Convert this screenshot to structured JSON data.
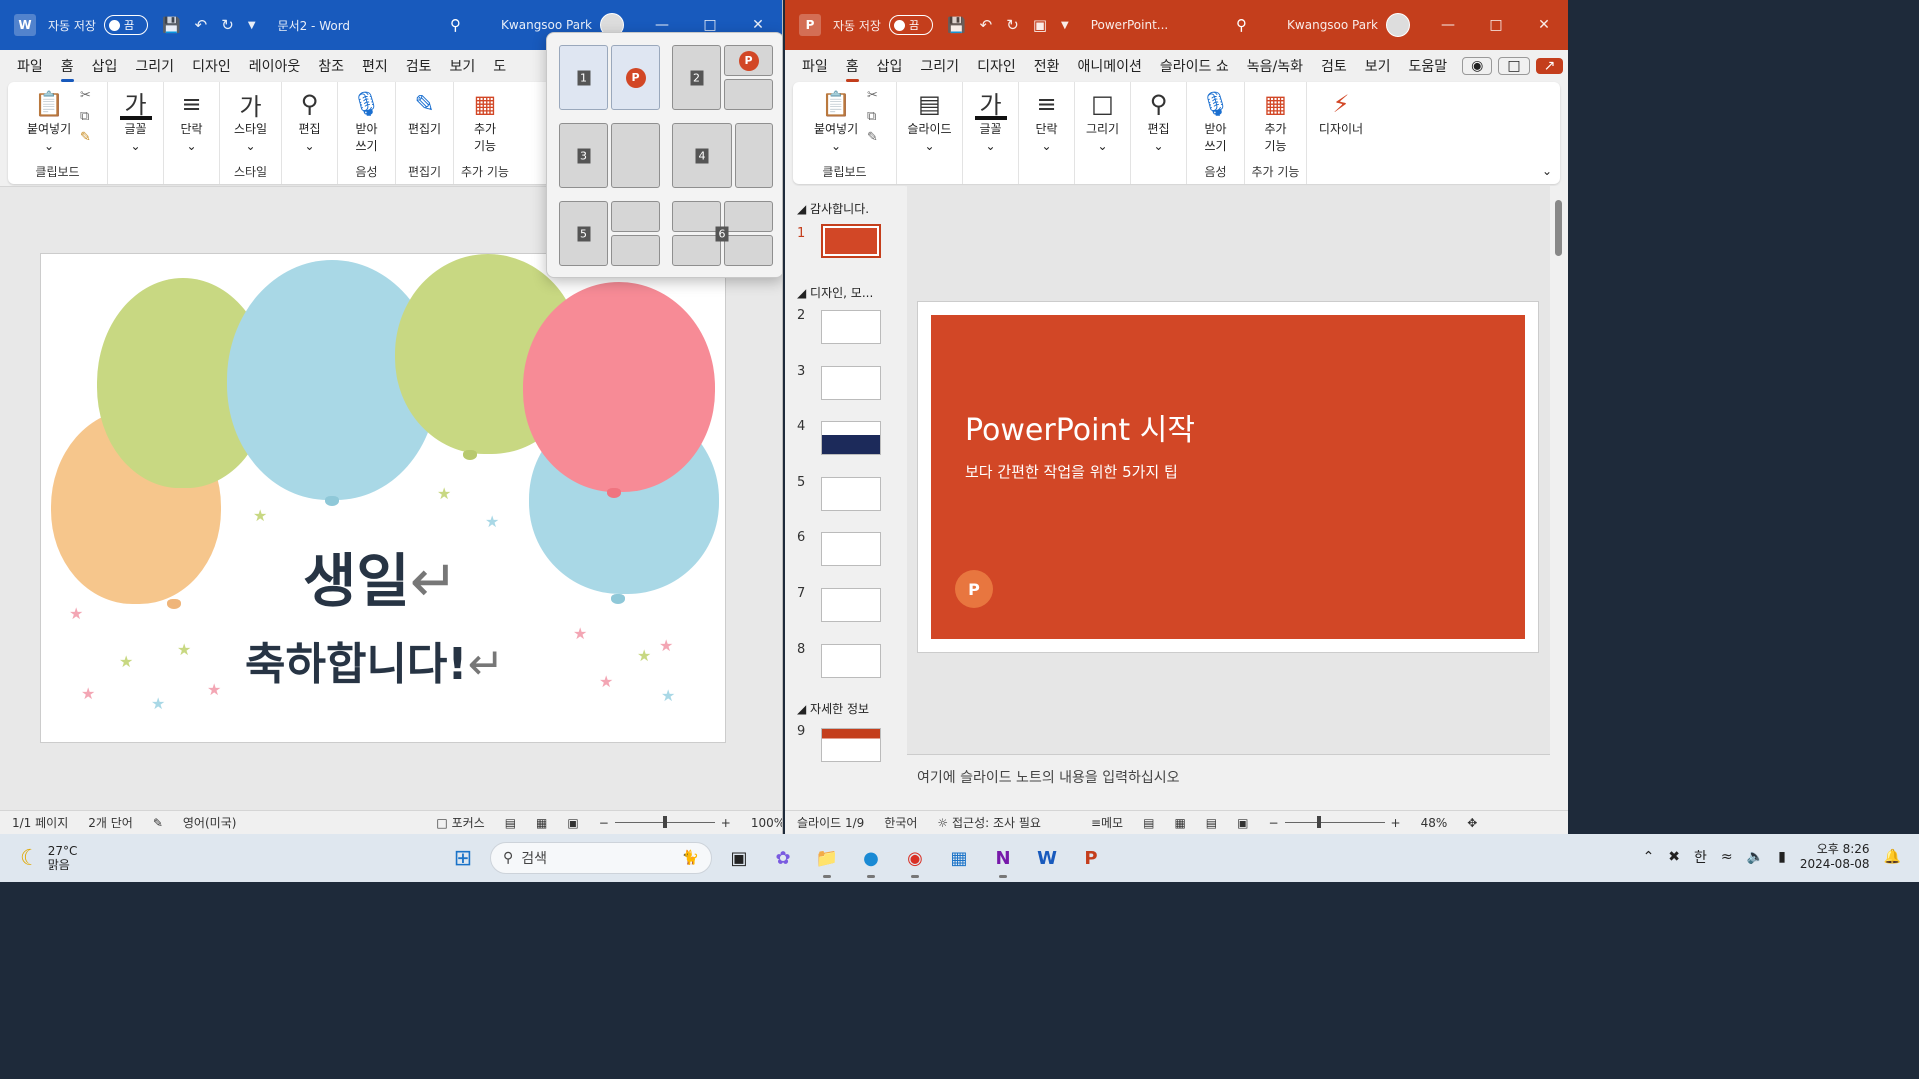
{
  "word": {
    "app_icon": "W",
    "autosave_label": "자동 저장",
    "autosave_state": "끔",
    "doc_title": "문서2  -  Word",
    "user": "Kwangsoo Park",
    "menu": [
      "파일",
      "홈",
      "삽입",
      "그리기",
      "디자인",
      "레이아웃",
      "참조",
      "편지",
      "검토",
      "보기",
      "도"
    ],
    "active_menu": "홈",
    "ribbon": {
      "paste": "붙여넣기",
      "clipboard_group": "클립보드",
      "font": "글꼴",
      "paragraph": "단락",
      "styles": "스타일",
      "styles_group": "스타일",
      "editing": "편집",
      "dictate_1": "받아",
      "dictate_2": "쓰기",
      "voice_group": "음성",
      "editor": "편집기",
      "editor_group": "편집기",
      "addins_1": "추가",
      "addins_2": "기능",
      "addins_group": "추가 기능"
    },
    "doc": {
      "line1": "생일",
      "line2": "축하합니다!",
      "para_mark": "↵"
    },
    "status": {
      "page": "1/1 페이지",
      "words": "2개 단어",
      "lang": "영어(미국)",
      "focus": "포커스",
      "zoom": "100%"
    }
  },
  "snap_layouts": {
    "zones": [
      "1",
      "2",
      "3",
      "4",
      "5",
      "6"
    ]
  },
  "ppt": {
    "app_icon": "P",
    "autosave_label": "자동 저장",
    "autosave_state": "끔",
    "doc_title": "PowerPoint...",
    "user": "Kwangsoo Park",
    "menu": [
      "파일",
      "홈",
      "삽입",
      "그리기",
      "디자인",
      "전환",
      "애니메이션",
      "슬라이드 쇼",
      "녹음/녹화",
      "검토",
      "보기",
      "도움말"
    ],
    "active_menu": "홈",
    "ribbon": {
      "paste": "붙여넣기",
      "clipboard_group": "클립보드",
      "slides": "슬라이드",
      "font": "글꼴",
      "paragraph": "단락",
      "drawing": "그리기",
      "editing": "편집",
      "dictate_1": "받아",
      "dictate_2": "쓰기",
      "voice_group": "음성",
      "addins_1": "추가",
      "addins_2": "기능",
      "addins_group": "추가 기능",
      "designer": "디자이너"
    },
    "sections": [
      {
        "title": "감사합니다.",
        "slides": [
          "1"
        ]
      },
      {
        "title": "디자인, 모...",
        "slides": [
          "2",
          "3",
          "4",
          "5",
          "6",
          "7",
          "8"
        ]
      },
      {
        "title": "자세한 정보",
        "slides": [
          "9"
        ]
      }
    ],
    "slide": {
      "title": "PowerPoint 시작",
      "subtitle": "보다 간편한 작업을 위한 5가지 팁",
      "logo": "P"
    },
    "notes_placeholder": "여기에 슬라이드 노트의 내용을 입력하십시오",
    "status": {
      "slide": "슬라이드 1/9",
      "lang": "한국어",
      "access": "접근성: 조사 필요",
      "memo": "메모",
      "zoom": "48%"
    }
  },
  "taskbar": {
    "temp": "27°C",
    "weather": "맑음",
    "search_placeholder": "검색",
    "ime": "한",
    "time": "오후 8:26",
    "date": "2024-08-08"
  }
}
